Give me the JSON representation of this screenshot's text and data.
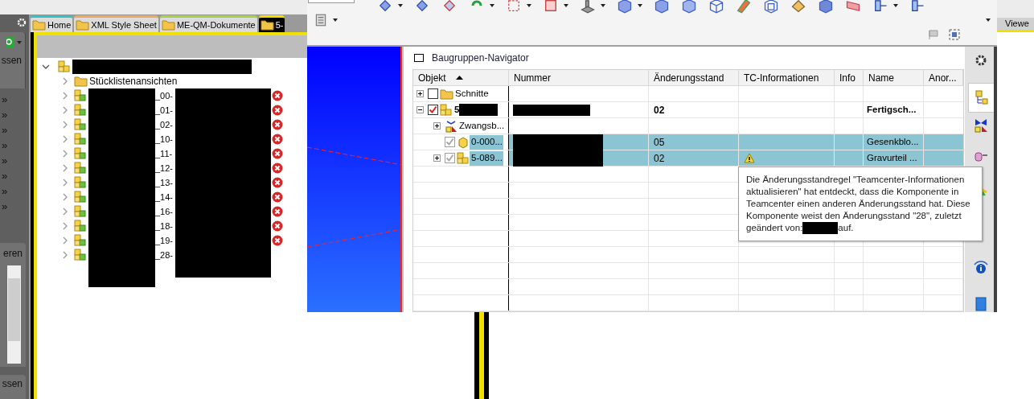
{
  "background_app": {
    "sidebar": {
      "top_label": "ssen",
      "links": [
        "»",
        "»",
        "»",
        "»",
        "»",
        "»",
        "»",
        "»"
      ],
      "middle_label": "eren",
      "bottom_label": "ssen"
    },
    "tabs": [
      {
        "label": "Home",
        "selected": false,
        "color": "#2ec4c4"
      },
      {
        "label": "XML Style Sheet",
        "selected": false,
        "color": "#f0a860"
      },
      {
        "label": "ME-QM-Dokumente",
        "selected": false,
        "color": "#a8d048"
      },
      {
        "label": "5-",
        "selected": true,
        "color": "#f0e000"
      }
    ],
    "tree": {
      "expanded": true,
      "children": [
        {
          "kind": "folder",
          "label": "Stücklistenansichten",
          "expanded": false,
          "error": false
        },
        {
          "kind": "part",
          "label": "_00-",
          "expanded": false,
          "error": true
        },
        {
          "kind": "part",
          "label": "_01-",
          "expanded": false,
          "error": true
        },
        {
          "kind": "part",
          "label": "_02-",
          "expanded": false,
          "error": true
        },
        {
          "kind": "part",
          "label": "_10-",
          "expanded": false,
          "error": true
        },
        {
          "kind": "part",
          "label": "_11-",
          "expanded": false,
          "error": true
        },
        {
          "kind": "part",
          "label": "_12-",
          "expanded": false,
          "error": true
        },
        {
          "kind": "part",
          "label": "_13-",
          "expanded": false,
          "error": true
        },
        {
          "kind": "part",
          "label": "_14-",
          "expanded": false,
          "error": true
        },
        {
          "kind": "part",
          "label": "_16-",
          "expanded": false,
          "error": true
        },
        {
          "kind": "part",
          "label": "_18-",
          "expanded": false,
          "error": true
        },
        {
          "kind": "part",
          "label": "_19-",
          "expanded": false,
          "error": true
        },
        {
          "kind": "part",
          "label": "_28-",
          "expanded": false,
          "error": false
        }
      ]
    },
    "right_tab": "Viewe"
  },
  "nx_window": {
    "navigator": {
      "title": "Baugruppen-Navigator",
      "columns": [
        {
          "label": "Objekt",
          "sorted": true
        },
        {
          "label": "Nummer"
        },
        {
          "label": "Änderungsstand"
        },
        {
          "label": "TC-Informationen"
        },
        {
          "label": "Info"
        },
        {
          "label": "Name"
        },
        {
          "label": "Anor..."
        }
      ],
      "rows": [
        {
          "kind": "folder",
          "label": "Schnitte",
          "expanded": false,
          "checked": false,
          "greyed": false,
          "selected": false
        },
        {
          "kind": "assembly",
          "label": "5",
          "expanded": true,
          "checked": true,
          "greyed": false,
          "selected": false,
          "work_part": true,
          "label_redacted": true,
          "number_redacted": true,
          "revision": "02",
          "name": "Fertigsch...",
          "children": [
            {
              "kind": "constraints",
              "label": "Zwangsb...",
              "expanded": false,
              "selected": false
            },
            {
              "kind": "part",
              "label": "0-000...",
              "checked": true,
              "greyed": true,
              "selected": true,
              "number_redacted": true,
              "revision": "05",
              "name": "Gesenkblo..."
            },
            {
              "kind": "assembly",
              "label": "5-089...",
              "expanded": false,
              "checked": true,
              "greyed": true,
              "selected": true,
              "number_redacted": true,
              "revision": "02",
              "name": "Gravurteil ...",
              "tc_warning": true
            }
          ]
        }
      ]
    },
    "tooltip": {
      "text": "Die Änderungsstandregel \"Teamcenter-Informationen aktualisieren\" hat entdeckt, dass die Komponente in Teamcenter einen anderen Änderungsstand hat. Diese Komponente weist den Änderungsstand \"28\", zuletzt",
      "text_before": "geändert von:",
      "redacted": true,
      "text_after": "auf."
    },
    "resource_tabs": [
      {
        "kind": "settings",
        "selected": false
      },
      {
        "kind": "assembly",
        "selected": true
      },
      {
        "kind": "constraints",
        "selected": false
      },
      {
        "kind": "database",
        "selected": false
      },
      {
        "kind": "reuse",
        "selected": false
      },
      {
        "kind": "info",
        "selected": false
      },
      {
        "kind": "book",
        "selected": false
      }
    ]
  }
}
